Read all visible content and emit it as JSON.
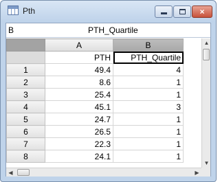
{
  "window": {
    "title": "Pth",
    "icon": "spreadsheet-icon",
    "controls": {
      "minimize": "minimize-icon",
      "maximize": "maximize-icon",
      "close": "×"
    }
  },
  "formula_bar": {
    "cell_ref": "B",
    "content": "PTH_Quartile"
  },
  "grid": {
    "columns": [
      "A",
      "B"
    ],
    "selected_column": "B",
    "column_names": [
      "PTH",
      "PTH_Quartile"
    ],
    "rows": [
      {
        "num": "1",
        "a": "49.4",
        "b": "4"
      },
      {
        "num": "2",
        "a": "8.6",
        "b": "1"
      },
      {
        "num": "3",
        "a": "25.4",
        "b": "1"
      },
      {
        "num": "4",
        "a": "45.1",
        "b": "3"
      },
      {
        "num": "5",
        "a": "24.7",
        "b": "1"
      },
      {
        "num": "6",
        "a": "26.5",
        "b": "1"
      },
      {
        "num": "7",
        "a": "22.3",
        "b": "1"
      },
      {
        "num": "8",
        "a": "24.1",
        "b": "1"
      }
    ]
  },
  "scrollbars": {
    "up": "▲",
    "down": "▼",
    "left": "◀",
    "right": "▶"
  }
}
